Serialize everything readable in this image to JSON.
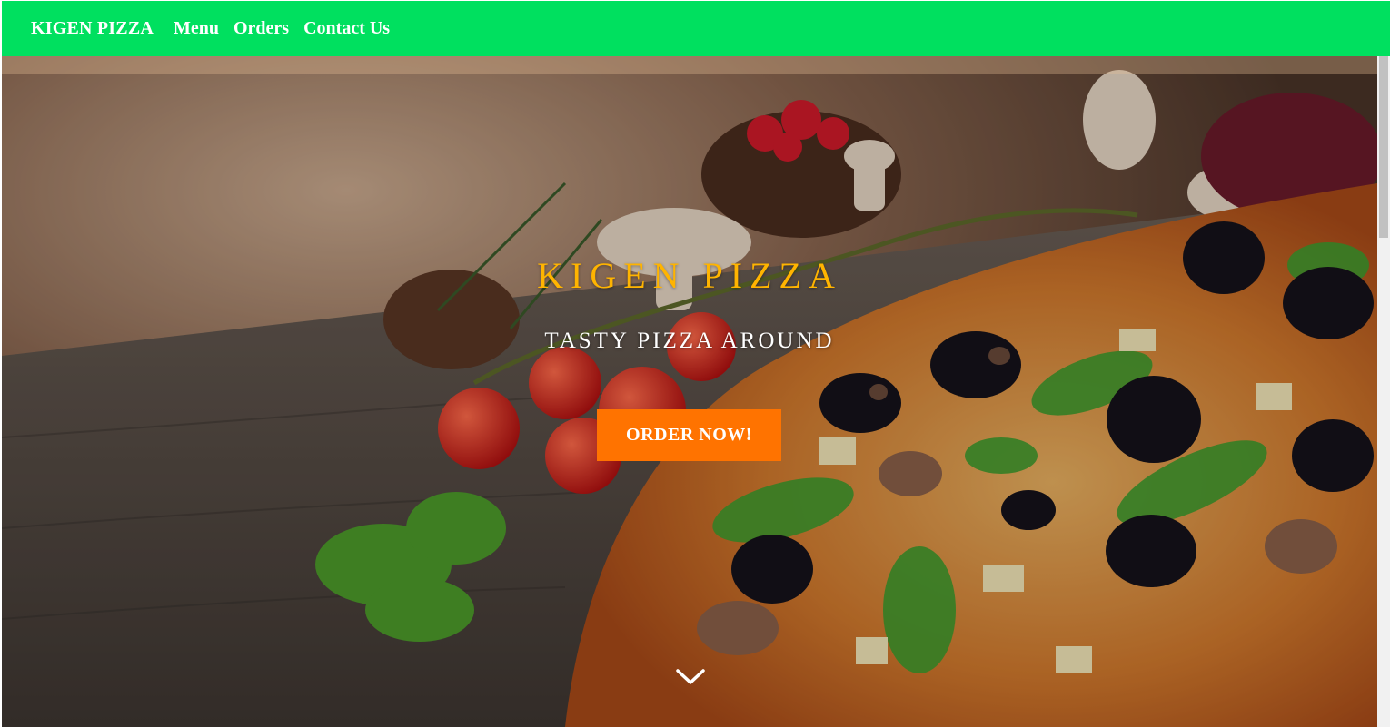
{
  "nav": {
    "brand": "KIGEN PIZZA",
    "links": [
      "Menu",
      "Orders",
      "Contact Us"
    ]
  },
  "hero": {
    "title": "KIGEN PIZZA",
    "subtitle": "TASTY PIZZA AROUND",
    "cta_label": "ORDER NOW!",
    "scroll_icon": "chevron-down-icon"
  },
  "colors": {
    "navbar": "#00e05f",
    "title": "#ffb400",
    "cta": "#ff7300",
    "text": "#ffffff"
  }
}
